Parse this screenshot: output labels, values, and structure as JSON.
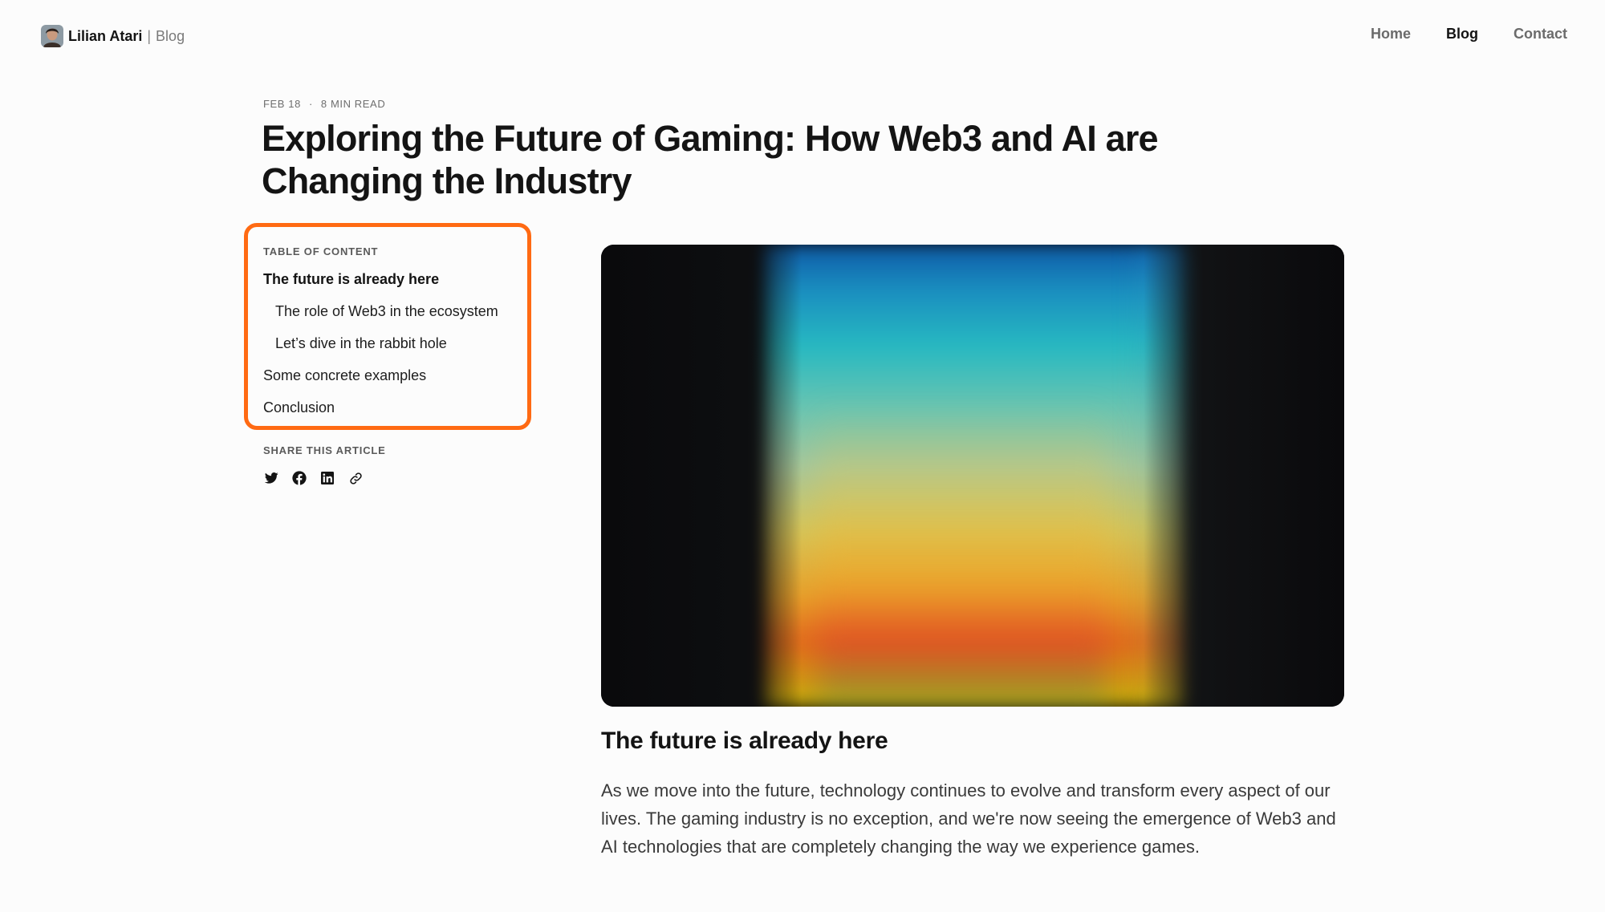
{
  "header": {
    "author_name": "Lilian Atari",
    "separator": "|",
    "section": "Blog",
    "nav": [
      {
        "label": "Home",
        "active": false
      },
      {
        "label": "Blog",
        "active": true
      },
      {
        "label": "Contact",
        "active": false
      }
    ]
  },
  "article": {
    "date": "FEB 18",
    "dot": "·",
    "read_time": "8 MIN READ",
    "title": "Exploring the Future of Gaming: How Web3 and AI are Changing the Industry",
    "section_heading": "The future is already here",
    "paragraph": "As we move into the future, technology continues to evolve and transform every aspect of our lives. The gaming industry is no exception, and we're now seeing the emergence of Web3 and AI technologies that are completely changing the way we experience games."
  },
  "toc": {
    "heading": "TABLE OF CONTENT",
    "items": [
      {
        "label": "The future is already here",
        "level": 1,
        "active": true
      },
      {
        "label": "The role of Web3 in the ecosystem",
        "level": 2,
        "active": false
      },
      {
        "label": "Let’s dive in the rabbit hole",
        "level": 2,
        "active": false
      },
      {
        "label": "Some concrete examples",
        "level": 1,
        "active": false
      },
      {
        "label": "Conclusion",
        "level": 1,
        "active": false
      }
    ],
    "highlight_color": "#ff6a13"
  },
  "share": {
    "heading": "SHARE THIS ARTICLE",
    "icons": [
      "twitter-icon",
      "facebook-icon",
      "linkedin-icon",
      "link-icon"
    ]
  },
  "colors": {
    "text": "#141414",
    "muted": "#6b6b6b",
    "background": "#fcfcfc"
  }
}
